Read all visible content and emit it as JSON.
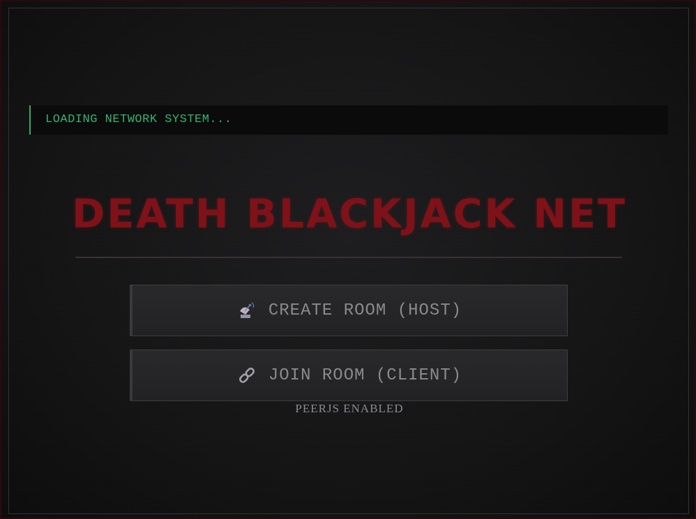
{
  "status": {
    "text": "LOADING NETWORK SYSTEM...",
    "accent_color": "#34b370"
  },
  "title": {
    "text": "DEATH BLACKJACK NET",
    "color": "#7e1218"
  },
  "menu": {
    "create_room": {
      "label": "CREATE ROOM (HOST)",
      "icon": "satellite-antenna-icon"
    },
    "join_room": {
      "label": "JOIN ROOM (CLIENT)",
      "icon": "link-icon"
    }
  },
  "footer": {
    "text": "PEERJS ENABLED"
  }
}
